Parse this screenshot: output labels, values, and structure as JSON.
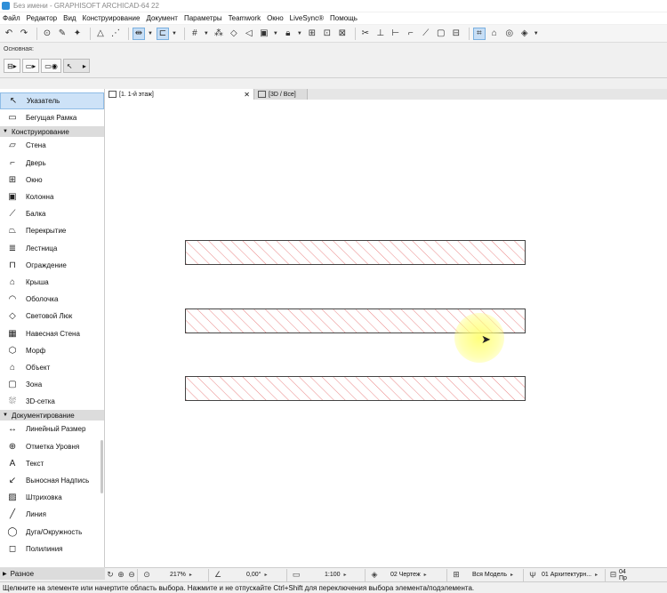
{
  "window": {
    "title": "Без имени - GRAPHISOFT ARCHICAD-64 22"
  },
  "menu": [
    "Файл",
    "Редактор",
    "Вид",
    "Конструирование",
    "Документ",
    "Параметры",
    "Teamwork",
    "Окно",
    "LiveSync®",
    "Помощь"
  ],
  "infobox": {
    "section_label": "Основная:"
  },
  "toolbox": {
    "top_tools": [
      {
        "label": "Указатель",
        "icon": "arrow-pointer-icon"
      },
      {
        "label": "Бегущая Рамка",
        "icon": "marquee-icon"
      }
    ],
    "groups": [
      {
        "name": "Конструирование",
        "tools": [
          {
            "label": "Стена",
            "icon": "wall-icon"
          },
          {
            "label": "Дверь",
            "icon": "door-icon"
          },
          {
            "label": "Окно",
            "icon": "window-icon"
          },
          {
            "label": "Колонна",
            "icon": "column-icon"
          },
          {
            "label": "Балка",
            "icon": "beam-icon"
          },
          {
            "label": "Перекрытие",
            "icon": "slab-icon"
          },
          {
            "label": "Лестница",
            "icon": "stair-icon"
          },
          {
            "label": "Ограждение",
            "icon": "railing-icon"
          },
          {
            "label": "Крыша",
            "icon": "roof-icon"
          },
          {
            "label": "Оболочка",
            "icon": "shell-icon"
          },
          {
            "label": "Световой Люк",
            "icon": "skylight-icon"
          },
          {
            "label": "Навесная Стена",
            "icon": "curtain-wall-icon"
          },
          {
            "label": "Морф",
            "icon": "morph-icon"
          },
          {
            "label": "Объект",
            "icon": "object-icon"
          },
          {
            "label": "Зона",
            "icon": "zone-icon"
          },
          {
            "label": "3D-сетка",
            "icon": "mesh-icon"
          }
        ]
      },
      {
        "name": "Документирование",
        "tools": [
          {
            "label": "Линейный Размер",
            "icon": "dimension-icon"
          },
          {
            "label": "Отметка Уровня",
            "icon": "level-dimension-icon"
          },
          {
            "label": "Текст",
            "icon": "text-icon"
          },
          {
            "label": "Выносная Надпись",
            "icon": "label-icon"
          },
          {
            "label": "Штриховка",
            "icon": "fill-icon"
          },
          {
            "label": "Линия",
            "icon": "line-icon"
          },
          {
            "label": "Дуга/Окружность",
            "icon": "arc-icon"
          },
          {
            "label": "Полилиния",
            "icon": "polyline-icon"
          }
        ]
      }
    ],
    "misc_group": "Разное",
    "glyphs": {
      "top": [
        "↖",
        "▭"
      ],
      "Конструирование": [
        "▱",
        "⌐",
        "⊞",
        "▣",
        "⟋",
        "⏢",
        "≣",
        "⊓",
        "⌂",
        "◠",
        "◇",
        "▦",
        "⬡",
        "⌂",
        "▢",
        "⛆"
      ],
      "Документирование": [
        "↔",
        "⊕",
        "A",
        "↙",
        "▨",
        "╱",
        "◯",
        "◻"
      ]
    }
  },
  "tabs": [
    {
      "label": "[1. 1-й этаж]",
      "active": true
    },
    {
      "label": "[3D / Все]",
      "active": false
    }
  ],
  "status": {
    "zoom": "217%",
    "angle": "0,00°",
    "scale": "1:100",
    "layer_combo": "02 Чертеж",
    "model_view": "Вся Модель",
    "pen_set": "01 Архитектурн...",
    "renovation": "04 Пр"
  },
  "hint": "Щелкните на элементе или начертите область выбора. Нажмите и не отпускайте Ctrl+Shift для переключения выбора элемента/подэлемента.",
  "walls": {
    "count": 3,
    "hatch_color": "#e87a7a",
    "outline_color": "#444444"
  },
  "accent_color": "#cde2f7"
}
